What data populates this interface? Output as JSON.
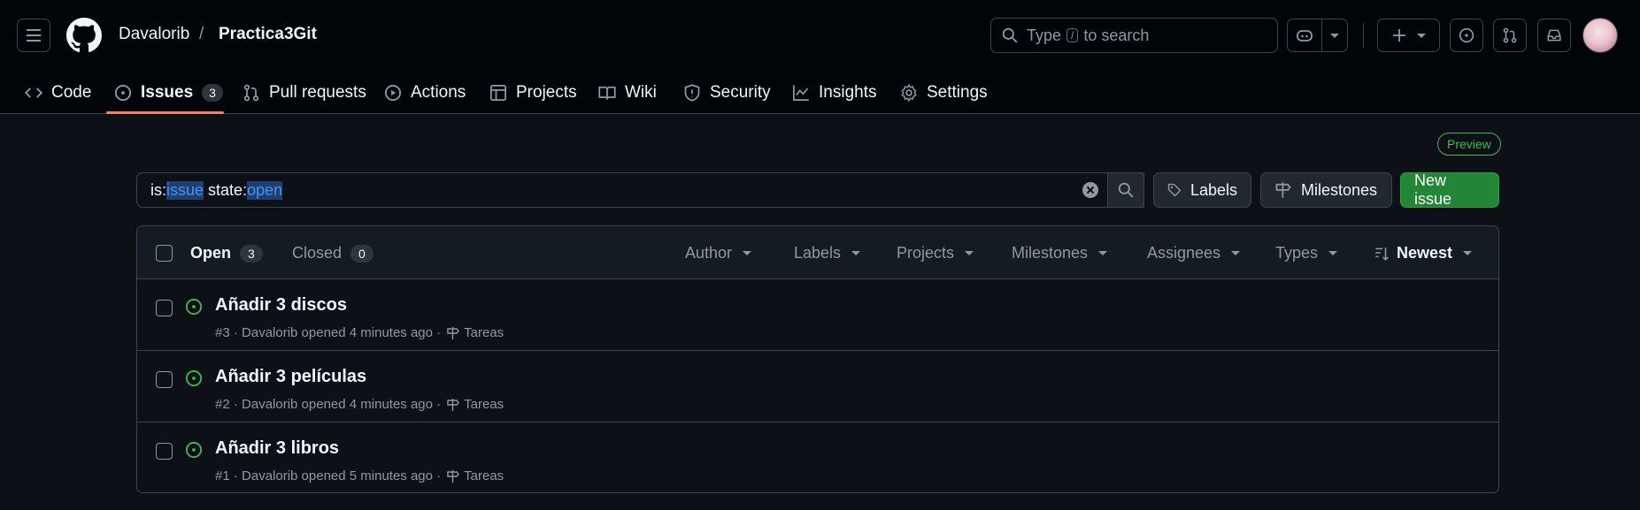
{
  "header": {
    "owner": "Davalorib",
    "separator": "/",
    "repo": "Practica3Git",
    "search": {
      "prefix": "Type",
      "key": "/",
      "suffix": "to search"
    }
  },
  "tabs": [
    {
      "label": "Code",
      "icon": "code-icon"
    },
    {
      "label": "Issues",
      "icon": "issue-opened-icon",
      "count": "3",
      "active": true
    },
    {
      "label": "Pull requests",
      "icon": "git-pull-request-icon"
    },
    {
      "label": "Actions",
      "icon": "play-icon"
    },
    {
      "label": "Projects",
      "icon": "table-icon"
    },
    {
      "label": "Wiki",
      "icon": "book-icon"
    },
    {
      "label": "Security",
      "icon": "shield-icon"
    },
    {
      "label": "Insights",
      "icon": "graph-icon"
    },
    {
      "label": "Settings",
      "icon": "gear-icon"
    }
  ],
  "preview_badge": "Preview",
  "filter": {
    "q1": "is:",
    "v1": "issue",
    "q2": "state:",
    "v2": "open"
  },
  "buttons": {
    "labels": "Labels",
    "milestones": "Milestones",
    "new_issue": "New issue"
  },
  "list": {
    "open_label": "Open",
    "open_count": "3",
    "closed_label": "Closed",
    "closed_count": "0",
    "filters": [
      "Author",
      "Labels",
      "Projects",
      "Milestones",
      "Assignees",
      "Types"
    ],
    "sort": "Newest"
  },
  "issues": [
    {
      "title": "Añadir 3 discos",
      "meta": "#3 · Davalorib opened 4 minutes ago ·",
      "milestone": "Tareas"
    },
    {
      "title": "Añadir 3 películas",
      "meta": "#2 · Davalorib opened 4 minutes ago ·",
      "milestone": "Tareas"
    },
    {
      "title": "Añadir 3 libros",
      "meta": "#1 · Davalorib opened 5 minutes ago ·",
      "milestone": "Tareas"
    }
  ],
  "colors": {
    "accent_green": "#238636",
    "open_icon": "#3fb950",
    "tab_underline": "#f78166",
    "link_blue": "#4493f8"
  }
}
